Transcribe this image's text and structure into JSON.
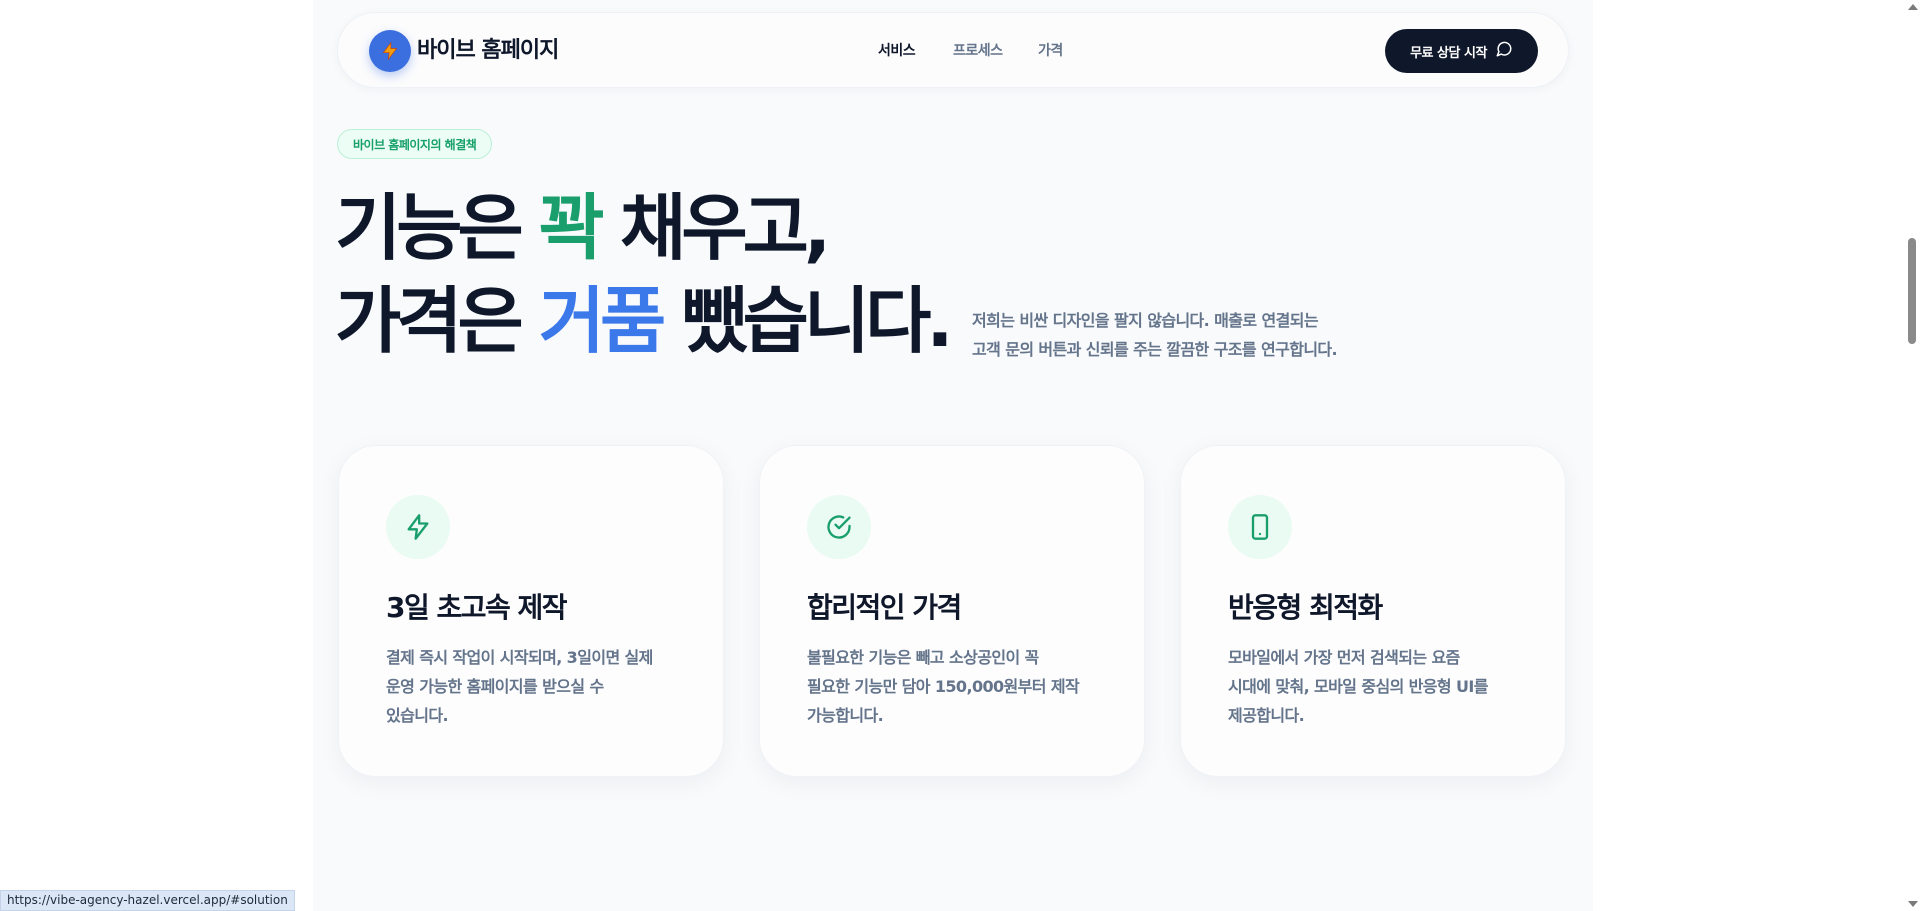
{
  "nav": {
    "logo_text": "바이브 홈페이지",
    "links": [
      "서비스",
      "프로세스",
      "가격"
    ],
    "cta_label": "무료 상담 시작"
  },
  "hero": {
    "badge": "바이브 홈페이지의 해결책",
    "line1_a": "기능은 ",
    "line1_highlight": "꽉",
    "line1_b": " 채우고,",
    "line2_a": "가격은 ",
    "line2_highlight": "거품",
    "line2_b": " 뺐습니다.",
    "description_line1": "저희는 비싼 디자인을 팔지 않습니다. 매출로 연결되는",
    "description_line2": "고객 문의 버튼과 신뢰를 주는 깔끔한 구조를 연구합니다."
  },
  "cards": [
    {
      "icon": "lightning-icon",
      "title": "3일 초고속 제작",
      "line1": "결제 즉시 작업이 시작되며, 3일이면 실제",
      "line2": "운영 가능한 홈페이지를 받으실 수",
      "line3": "있습니다."
    },
    {
      "icon": "check-circle-icon",
      "title": "합리적인 가격",
      "line1": "불필요한 기능은 빼고 소상공인이 꼭",
      "line2": "필요한 기능만 담아 150,000원부터 제작",
      "line3": "가능합니다."
    },
    {
      "icon": "smartphone-icon",
      "title": "반응형 최적화",
      "line1": "모바일에서 가장 먼저 검색되는 요즘",
      "line2": "시대에 맞춰, 모바일 중심의 반응형 UI를",
      "line3": "제공합니다."
    }
  ],
  "status_url": "https://vibe-agency-hazel.vercel.app/#solution",
  "colors": {
    "accent_green": "#1a9e6c",
    "accent_blue": "#3b78ea",
    "dark": "#0f172a",
    "muted": "#64748b"
  }
}
